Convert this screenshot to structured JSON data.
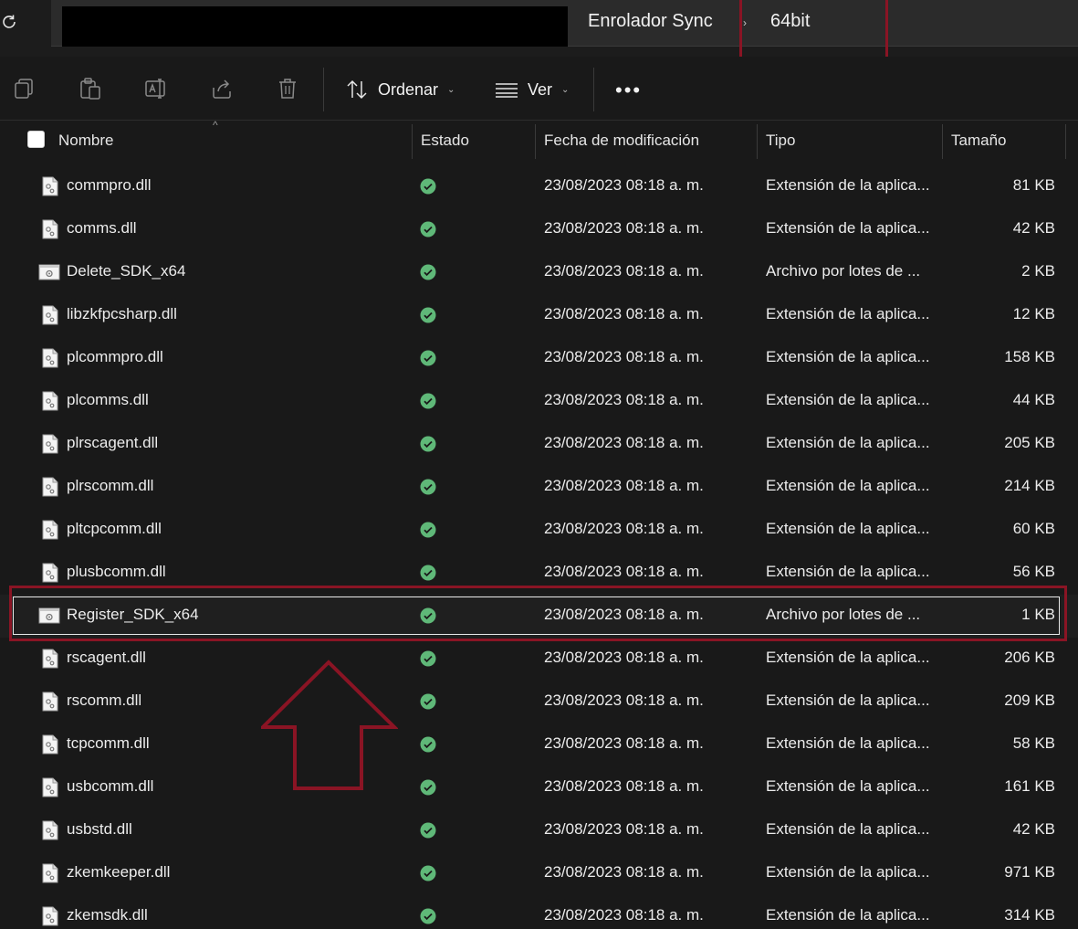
{
  "address_bar": {
    "breadcrumbs": [
      {
        "label": "Enrolador Sync"
      },
      {
        "label": "64bit"
      }
    ],
    "separator": "›",
    "refresh_icon": "refresh-icon"
  },
  "toolbar": {
    "icons": [
      "copy-icon",
      "paste-icon",
      "rename-icon",
      "share-icon",
      "delete-icon"
    ],
    "sort_label": "Ordenar",
    "view_label": "Ver",
    "more_label": "•••"
  },
  "columns": {
    "name": "Nombre",
    "status": "Estado",
    "date": "Fecha de modificación",
    "type": "Tipo",
    "size": "Tamaño"
  },
  "files": [
    {
      "name": "commpro.dll",
      "date": "23/08/2023 08:18 a. m.",
      "type": "Extensión de la aplica...",
      "size": "81 KB",
      "kind": "dll"
    },
    {
      "name": "comms.dll",
      "date": "23/08/2023 08:18 a. m.",
      "type": "Extensión de la aplica...",
      "size": "42 KB",
      "kind": "dll"
    },
    {
      "name": "Delete_SDK_x64",
      "date": "23/08/2023 08:18 a. m.",
      "type": "Archivo por lotes de ...",
      "size": "2 KB",
      "kind": "bat"
    },
    {
      "name": "libzkfpcsharp.dll",
      "date": "23/08/2023 08:18 a. m.",
      "type": "Extensión de la aplica...",
      "size": "12 KB",
      "kind": "dll"
    },
    {
      "name": "plcommpro.dll",
      "date": "23/08/2023 08:18 a. m.",
      "type": "Extensión de la aplica...",
      "size": "158 KB",
      "kind": "dll"
    },
    {
      "name": "plcomms.dll",
      "date": "23/08/2023 08:18 a. m.",
      "type": "Extensión de la aplica...",
      "size": "44 KB",
      "kind": "dll"
    },
    {
      "name": "plrscagent.dll",
      "date": "23/08/2023 08:18 a. m.",
      "type": "Extensión de la aplica...",
      "size": "205 KB",
      "kind": "dll"
    },
    {
      "name": "plrscomm.dll",
      "date": "23/08/2023 08:18 a. m.",
      "type": "Extensión de la aplica...",
      "size": "214 KB",
      "kind": "dll"
    },
    {
      "name": "pltcpcomm.dll",
      "date": "23/08/2023 08:18 a. m.",
      "type": "Extensión de la aplica...",
      "size": "60 KB",
      "kind": "dll"
    },
    {
      "name": "plusbcomm.dll",
      "date": "23/08/2023 08:18 a. m.",
      "type": "Extensión de la aplica...",
      "size": "56 KB",
      "kind": "dll"
    },
    {
      "name": "Register_SDK_x64",
      "date": "23/08/2023 08:18 a. m.",
      "type": "Archivo por lotes de ...",
      "size": "1 KB",
      "kind": "bat"
    },
    {
      "name": "rscagent.dll",
      "date": "23/08/2023 08:18 a. m.",
      "type": "Extensión de la aplica...",
      "size": "206 KB",
      "kind": "dll"
    },
    {
      "name": "rscomm.dll",
      "date": "23/08/2023 08:18 a. m.",
      "type": "Extensión de la aplica...",
      "size": "209 KB",
      "kind": "dll"
    },
    {
      "name": "tcpcomm.dll",
      "date": "23/08/2023 08:18 a. m.",
      "type": "Extensión de la aplica...",
      "size": "58 KB",
      "kind": "dll"
    },
    {
      "name": "usbcomm.dll",
      "date": "23/08/2023 08:18 a. m.",
      "type": "Extensión de la aplica...",
      "size": "161 KB",
      "kind": "dll"
    },
    {
      "name": "usbstd.dll",
      "date": "23/08/2023 08:18 a. m.",
      "type": "Extensión de la aplica...",
      "size": "42 KB",
      "kind": "dll"
    },
    {
      "name": "zkemkeeper.dll",
      "date": "23/08/2023 08:18 a. m.",
      "type": "Extensión de la aplica...",
      "size": "971 KB",
      "kind": "dll"
    },
    {
      "name": "zkemsdk.dll",
      "date": "23/08/2023 08:18 a. m.",
      "type": "Extensión de la aplica...",
      "size": "314 KB",
      "kind": "dll"
    }
  ],
  "selected_file": "Register_SDK_x64",
  "colors": {
    "background": "#191919",
    "status_ok": "#5fb878",
    "annotation": "#8a1424"
  }
}
